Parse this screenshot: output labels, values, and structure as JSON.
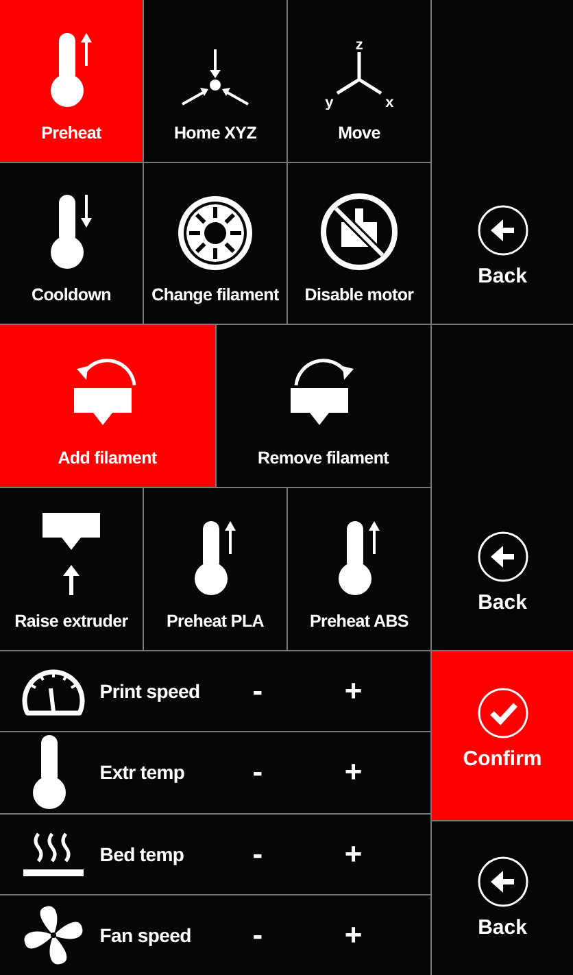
{
  "screens": [
    {
      "top_tiles": [
        {
          "kind": "preheat",
          "label": "Preheat",
          "selected": true
        },
        {
          "kind": "home",
          "label": "Home XYZ",
          "selected": false
        },
        {
          "kind": "move",
          "label": "Move",
          "selected": false,
          "axis_labels": [
            "z",
            "y",
            "x"
          ]
        }
      ],
      "bottom_tiles": [
        {
          "kind": "cooldown",
          "label": "Cooldown",
          "selected": false
        },
        {
          "kind": "change_filament",
          "label": "Change filament",
          "selected": false
        },
        {
          "kind": "disable_motor",
          "label": "Disable motor",
          "selected": false
        }
      ],
      "back": {
        "label": "Back",
        "selected": false
      }
    },
    {
      "top_tiles": [
        {
          "kind": "add_filament",
          "label": "Add filament",
          "selected": true
        },
        {
          "kind": "remove_filament",
          "label": "Remove filament",
          "selected": false
        }
      ],
      "bottom_tiles": [
        {
          "kind": "raise_extruder",
          "label": "Raise extruder",
          "selected": false
        },
        {
          "kind": "preheat",
          "label": "Preheat PLA",
          "selected": false
        },
        {
          "kind": "preheat",
          "label": "Preheat ABS",
          "selected": false
        }
      ],
      "back": {
        "label": "Back",
        "selected": false
      }
    }
  ],
  "adjust": {
    "rows": [
      {
        "kind": "speed",
        "label": "Print speed",
        "minus": "-",
        "plus": "+"
      },
      {
        "kind": "thermometer",
        "label": "Extr temp",
        "minus": "-",
        "plus": "+"
      },
      {
        "kind": "bed",
        "label": "Bed temp",
        "minus": "-",
        "plus": "+"
      },
      {
        "kind": "fan",
        "label": "Fan speed",
        "minus": "-",
        "plus": "+"
      }
    ],
    "confirm": {
      "label": "Confirm",
      "selected": true
    },
    "back": {
      "label": "Back",
      "selected": false
    }
  }
}
